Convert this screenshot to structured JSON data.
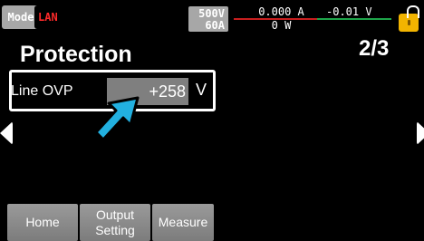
{
  "header": {
    "mode_badge": "Mode",
    "lan_badge": "LAN",
    "rating_voltage": "500V",
    "rating_current": "60A",
    "measured_current": "0.000 A",
    "measured_power": "0 W",
    "measured_voltage": "-0.01 V",
    "colors": {
      "lan_text": "#ff2a2a",
      "current_rule": "#c81f1f",
      "voltage_rule": "#1ea44a",
      "lock": "#f2b400"
    },
    "lock_icon": "lock-open-icon"
  },
  "page": {
    "title": "Protection",
    "page_number": "2/3"
  },
  "setting": {
    "label": "Line OVP",
    "value": "+258",
    "unit": "V"
  },
  "softkeys": {
    "home": "Home",
    "output_line1": "Output",
    "output_line2": "Setting",
    "measure": "Measure"
  },
  "icons": {
    "cursor": "pointer-arrow-icon",
    "prev": "left-arrow-icon",
    "next": "right-arrow-icon"
  }
}
